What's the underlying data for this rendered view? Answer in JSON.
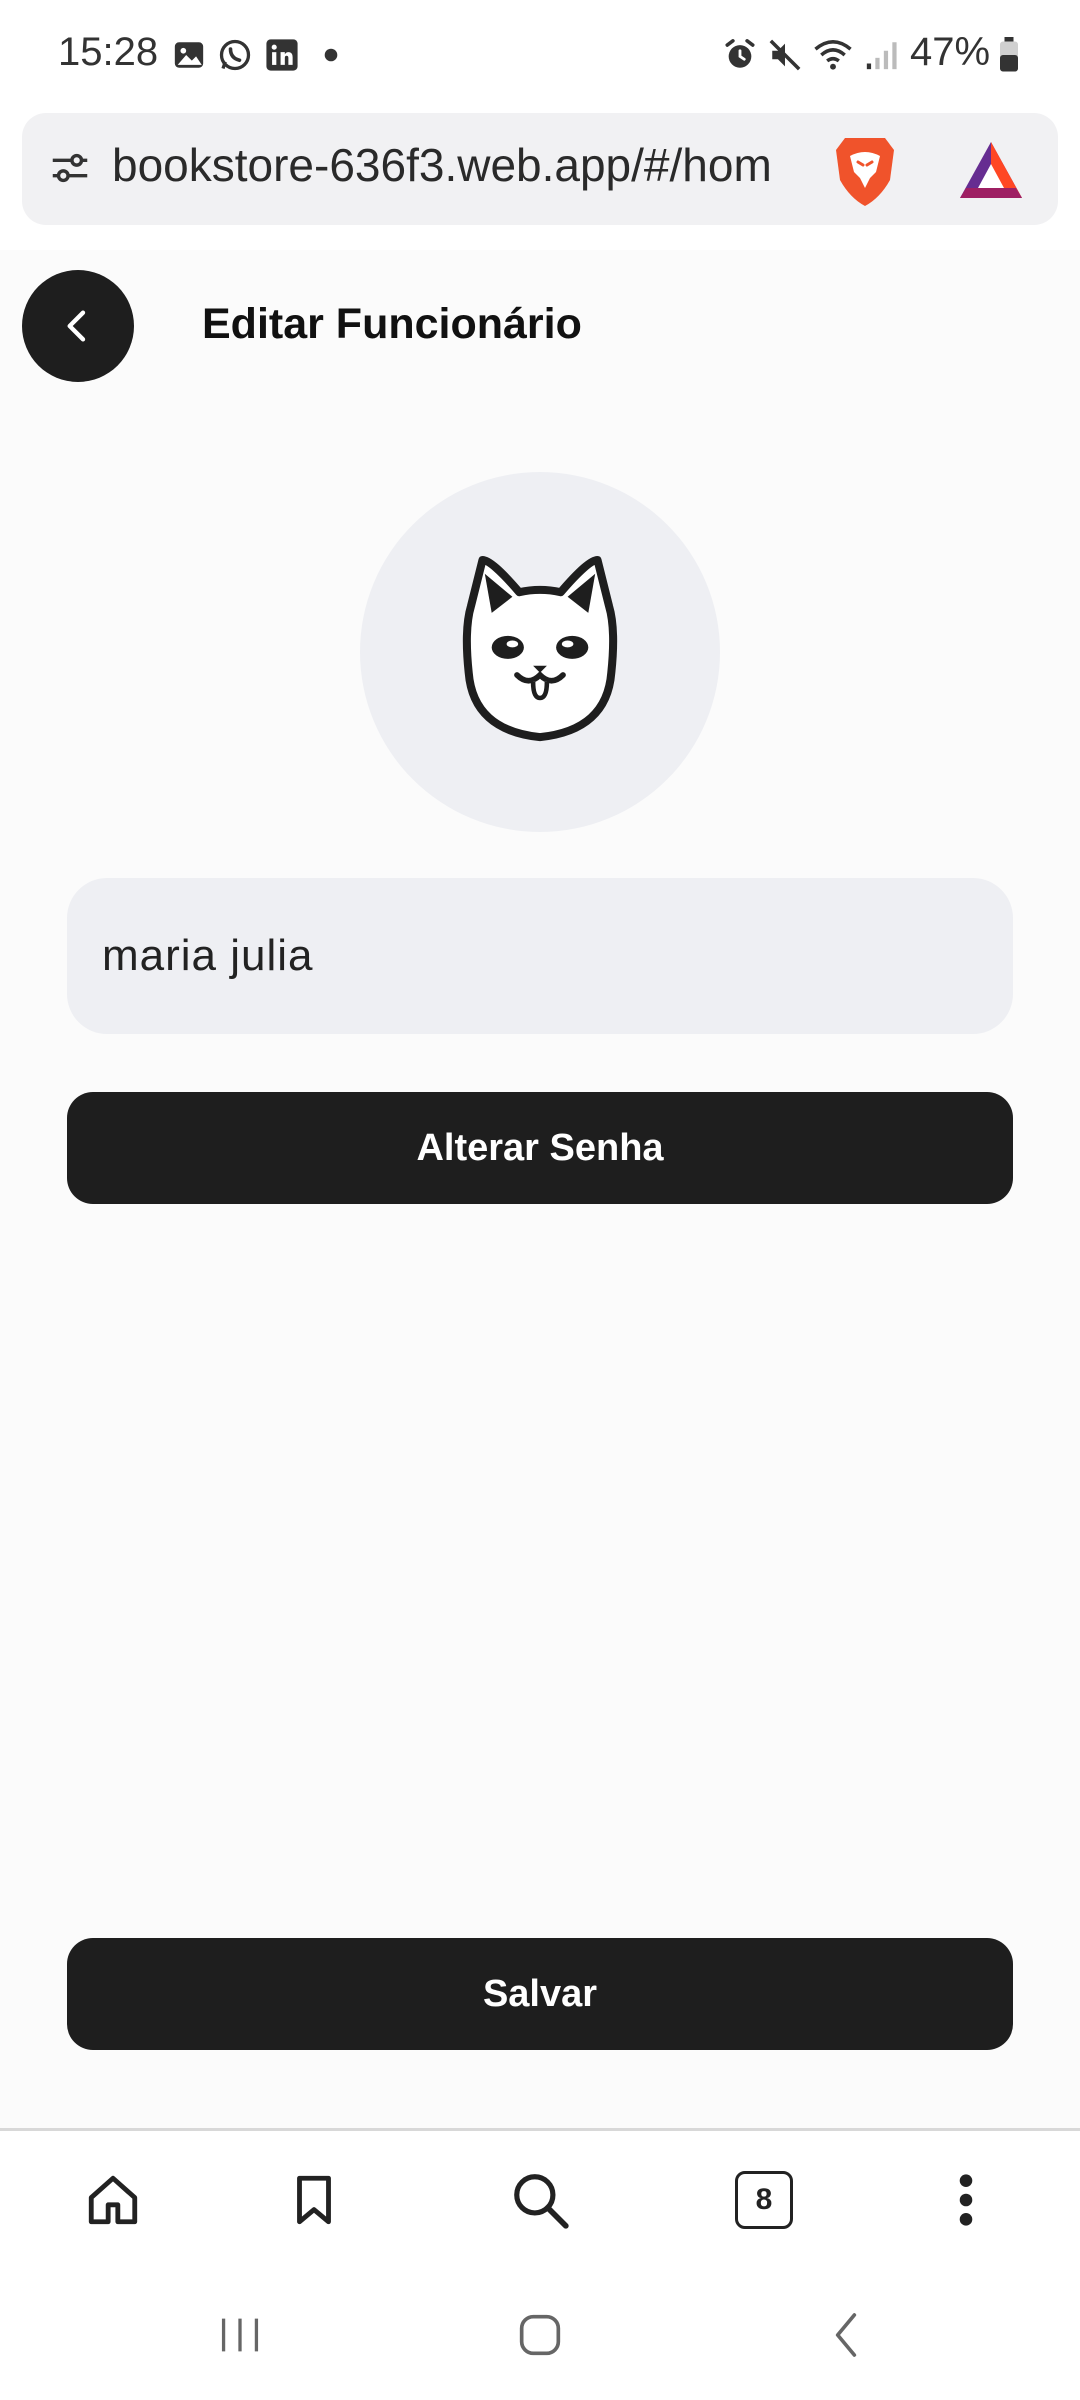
{
  "status_bar": {
    "time": "15:28",
    "battery": "47%",
    "icons": [
      "gallery-icon",
      "whatsapp-icon",
      "linkedin-icon",
      "dot-icon",
      "alarm-icon",
      "mute-icon",
      "wifi-icon",
      "signal-icon",
      "battery-icon"
    ]
  },
  "browser": {
    "url": "bookstore-636f3.web.app/#/hom",
    "icons": [
      "site-settings-icon",
      "brave-shield-icon",
      "bat-rewards-icon"
    ]
  },
  "header": {
    "title": "Editar Funcionário"
  },
  "form": {
    "name_value": "maria julia",
    "change_password_label": "Alterar Senha",
    "save_label": "Salvar"
  },
  "toolbar": {
    "tab_count": "8",
    "icons": [
      "home-icon",
      "bookmark-icon",
      "search-icon",
      "tabs-icon",
      "more-icon"
    ]
  },
  "nav": {
    "icons": [
      "recent-apps-icon",
      "home-nav-icon",
      "back-nav-icon"
    ]
  },
  "colors": {
    "accent_dark": "#1e1e1e",
    "field_bg": "#eeeff3",
    "page_bg": "#fbfbfb"
  }
}
